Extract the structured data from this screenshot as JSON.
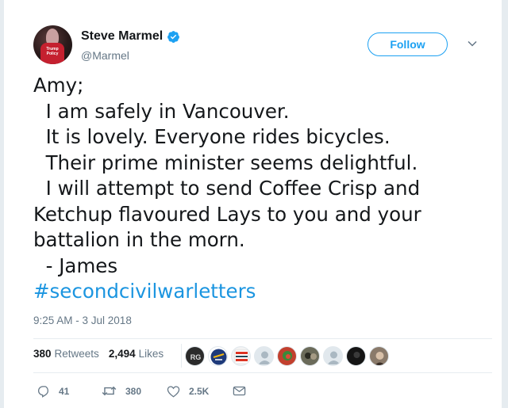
{
  "user": {
    "name": "Steve Marmel",
    "handle": "@Marmel",
    "avatar_sign_text": "Trump Policy"
  },
  "follow_label": "Follow",
  "tweet": {
    "lines": [
      "Amy;",
      "  I am safely in Vancouver.",
      "  It is lovely. Everyone rides bicycles.",
      "  Their prime minister seems delightful.",
      "  I will attempt to send Coffee Crisp and",
      "Ketchup flavoured Lays to you and your",
      "battalion in the morn.",
      "  - James"
    ],
    "hashtag": "#secondcivilwarletters"
  },
  "timestamp": "9:25 AM - 3 Jul 2018",
  "stats": {
    "retweets_count": "380",
    "retweets_label": "Retweets",
    "likes_count": "2,494",
    "likes_label": "Likes"
  },
  "likers": [
    {
      "icon": "avatar-dark-logo",
      "color": "#2b2b2b"
    },
    {
      "icon": "avatar-sabres-logo",
      "color": "#1e3a7a"
    },
    {
      "icon": "avatar-sign",
      "color": "#f3f3f3",
      "text": "ANTI BIGOT PRO LOVE"
    },
    {
      "icon": "avatar-default-egg",
      "color": "#ccd6dd"
    },
    {
      "icon": "avatar-red-photo",
      "color": "#c2402e"
    },
    {
      "icon": "avatar-group-photo",
      "color": "#6b6b5a"
    },
    {
      "icon": "avatar-default-egg",
      "color": "#ccd6dd"
    },
    {
      "icon": "avatar-dark-photo",
      "color": "#151515"
    },
    {
      "icon": "avatar-portrait-photo",
      "color": "#8a7a6a"
    }
  ],
  "actions": {
    "replies": "41",
    "retweets": "380",
    "likes": "2.5K"
  },
  "colors": {
    "accent": "#1da1f2",
    "hashtag": "#1b95e0",
    "secondary_text": "#657786",
    "divider": "#e6ecf0"
  }
}
